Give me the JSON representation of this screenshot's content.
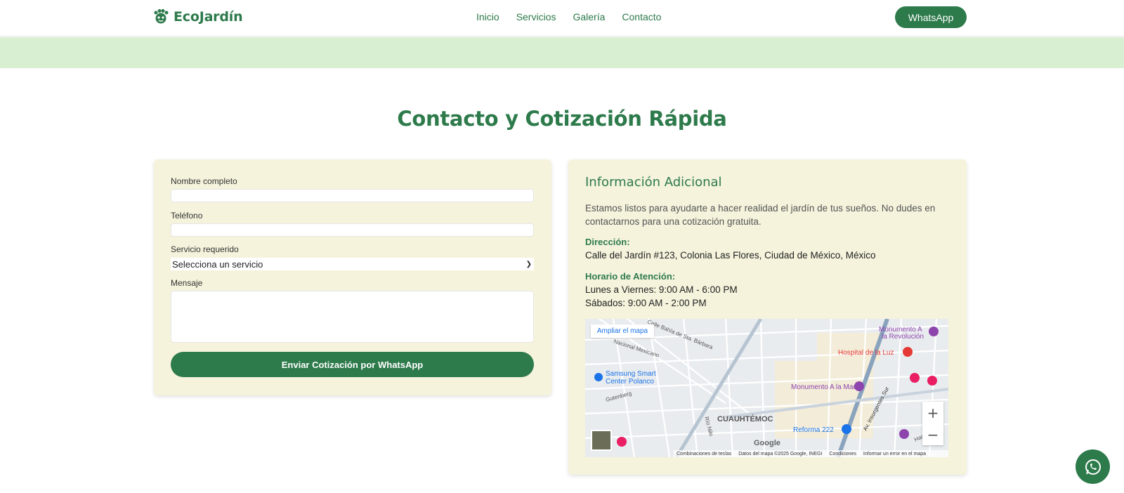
{
  "header": {
    "brand": "EcoJardín",
    "nav": [
      "Inicio",
      "Servicios",
      "Galería",
      "Contacto"
    ],
    "whatsapp_label": "WhatsApp"
  },
  "section": {
    "title": "Contacto y Cotización Rápida"
  },
  "form": {
    "name_label": "Nombre completo",
    "phone_label": "Teléfono",
    "service_label": "Servicio requerido",
    "service_selected": "Selecciona un servicio",
    "message_label": "Mensaje",
    "submit_label": "Enviar Cotización por WhatsApp"
  },
  "info": {
    "title": "Información Adicional",
    "intro": "Estamos listos para ayudarte a hacer realidad el jardín de tus sueños. No dudes en contactarnos para una cotización gratuita.",
    "address_label": "Dirección:",
    "address": "Calle del Jardín #123, Colonia Las Flores, Ciudad de México, México",
    "hours_label": "Horario de Atención:",
    "hours_weekdays": "Lunes a Viernes: 9:00 AM - 6:00 PM",
    "hours_saturday": "Sábados: 9:00 AM - 2:00 PM"
  },
  "map": {
    "enlarge_link": "Ampliar el mapa",
    "labels": {
      "monumento_revolucion_1": "Monumento A",
      "monumento_revolucion_2": "la Revolución",
      "hospital": "Hospital de la Luz",
      "samsung_1": "Samsung Smart",
      "samsung_2": "Center Polanco",
      "monumento_madre": "Monumento A la Madre",
      "cuauhtemoc": "CUAUHTÉMOC",
      "reforma": "Reforma 222",
      "nacional_mexicano": "Nacional Mexicano",
      "gutenberg": "Gutenberg",
      "bahia": "Calle Bahía de Sta. Bárbara",
      "insurgentes": "Av. Insurgentes Sur",
      "hamburgo": "Hamburgo",
      "rio_nilo": "Río Nilo",
      "google": "Google"
    },
    "footer": [
      "Combinaciones de teclas",
      "Datos del mapa ©2025 Google, INEGI",
      "Condiciones",
      "Informar un error en el mapa"
    ]
  },
  "colors": {
    "primary": "#2d7a4b",
    "banner": "#d8efd2",
    "card": "#f5f3dc"
  },
  "icons": {
    "logo": "leaf-paw-icon",
    "float": "whatsapp-icon",
    "zoom_in": "plus-icon",
    "zoom_out": "minus-icon"
  }
}
